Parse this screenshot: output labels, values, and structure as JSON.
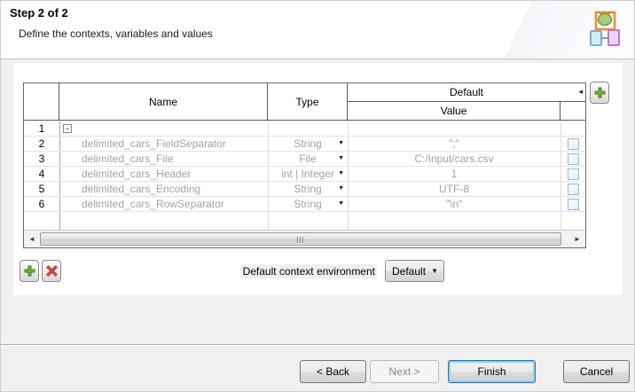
{
  "header": {
    "title": "Step 2 of 2",
    "subtitle": "Define the contexts, variables and values"
  },
  "table": {
    "columns": {
      "name": "Name",
      "type": "Type",
      "default_group": "Default",
      "value": "Value"
    },
    "rows": [
      {
        "num": "1",
        "name": "",
        "type": "",
        "value": ""
      },
      {
        "num": "2",
        "name": "delimited_cars_FieldSeparator",
        "type": "String",
        "value": "\";\""
      },
      {
        "num": "3",
        "name": "delimited_cars_File",
        "type": "File",
        "value": "C:/Input/cars.csv"
      },
      {
        "num": "4",
        "name": "delimited_cars_Header",
        "type": "int | Integer",
        "value": "1"
      },
      {
        "num": "5",
        "name": "delimited_cars_Encoding",
        "type": "String",
        "value": "UTF-8"
      },
      {
        "num": "6",
        "name": "delimited_cars_RowSeparator",
        "type": "String",
        "value": "\"\\n\""
      }
    ]
  },
  "controls": {
    "env_label": "Default context environment",
    "env_value": "Default"
  },
  "buttons": {
    "back": "< Back",
    "next": "Next >",
    "finish": "Finish",
    "cancel": "Cancel"
  },
  "icons": {
    "collapse": "−",
    "dropdown_arrow": "▼",
    "header_arrow": "◂",
    "scroll_left": "◄",
    "scroll_right": "►"
  },
  "colors": {
    "finish_glow": "#8ed1f2",
    "plus_green": "#6cb33e",
    "remove_red": "#cf4a4a",
    "checkbox_border": "#94b9d2"
  }
}
